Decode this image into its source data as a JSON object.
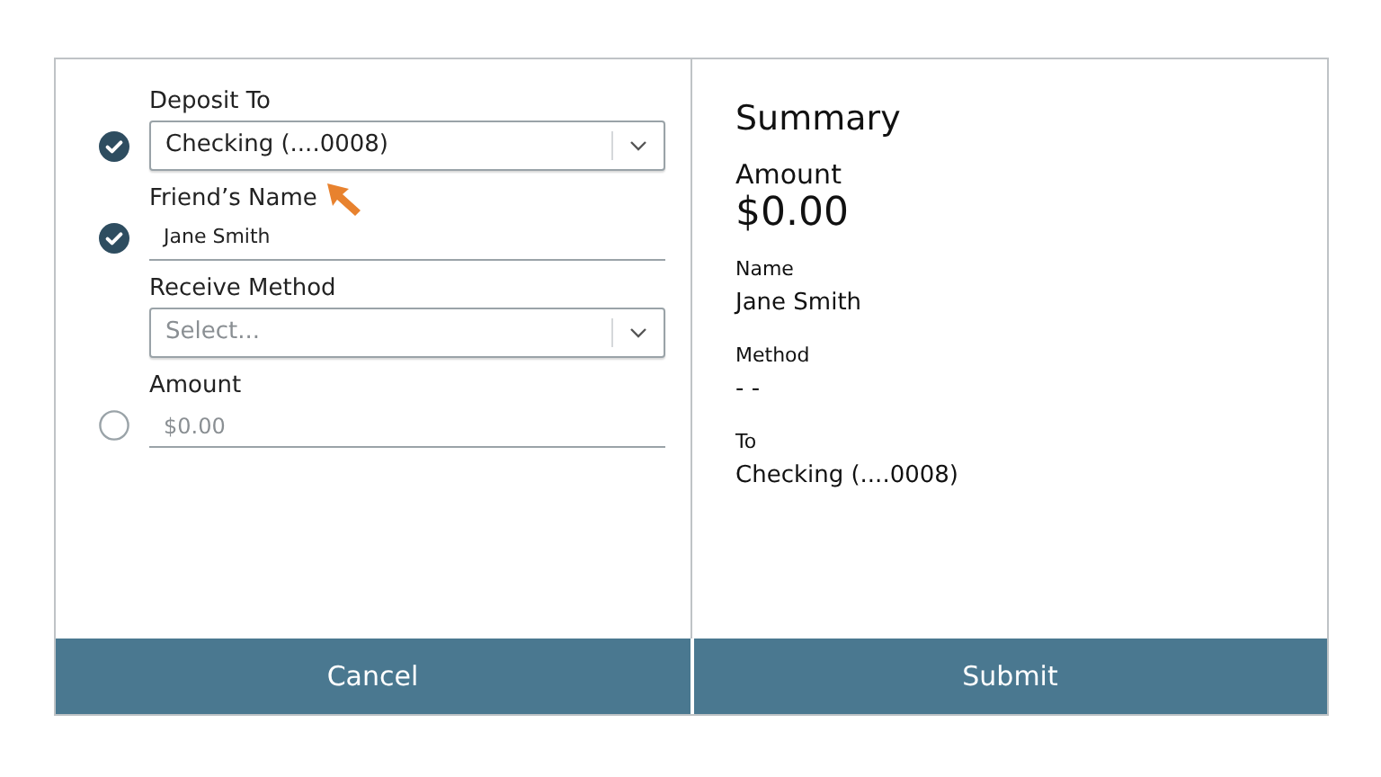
{
  "form": {
    "fields": [
      {
        "kind": "select",
        "label": "Deposit To",
        "value": "Checking (....0008)",
        "has_status": true,
        "done": true
      },
      {
        "kind": "text",
        "label": "Friend’s Name",
        "value": "Jane Smith",
        "has_status": true,
        "done": true
      },
      {
        "kind": "select",
        "label": "Receive Method",
        "placeholder": "Select...",
        "has_status": false
      },
      {
        "kind": "text",
        "label": "Amount",
        "placeholder": "$0.00",
        "has_status": true,
        "done": false
      }
    ]
  },
  "summary": {
    "title": "Summary",
    "amount_label": "Amount",
    "amount": "$0.00",
    "items": [
      {
        "label": "Name",
        "value": "Jane Smith"
      },
      {
        "label": "Method",
        "value": "- -"
      },
      {
        "label": "To",
        "value": "Checking (....0008)"
      }
    ]
  },
  "buttons": [
    "Cancel",
    "Submit"
  ]
}
